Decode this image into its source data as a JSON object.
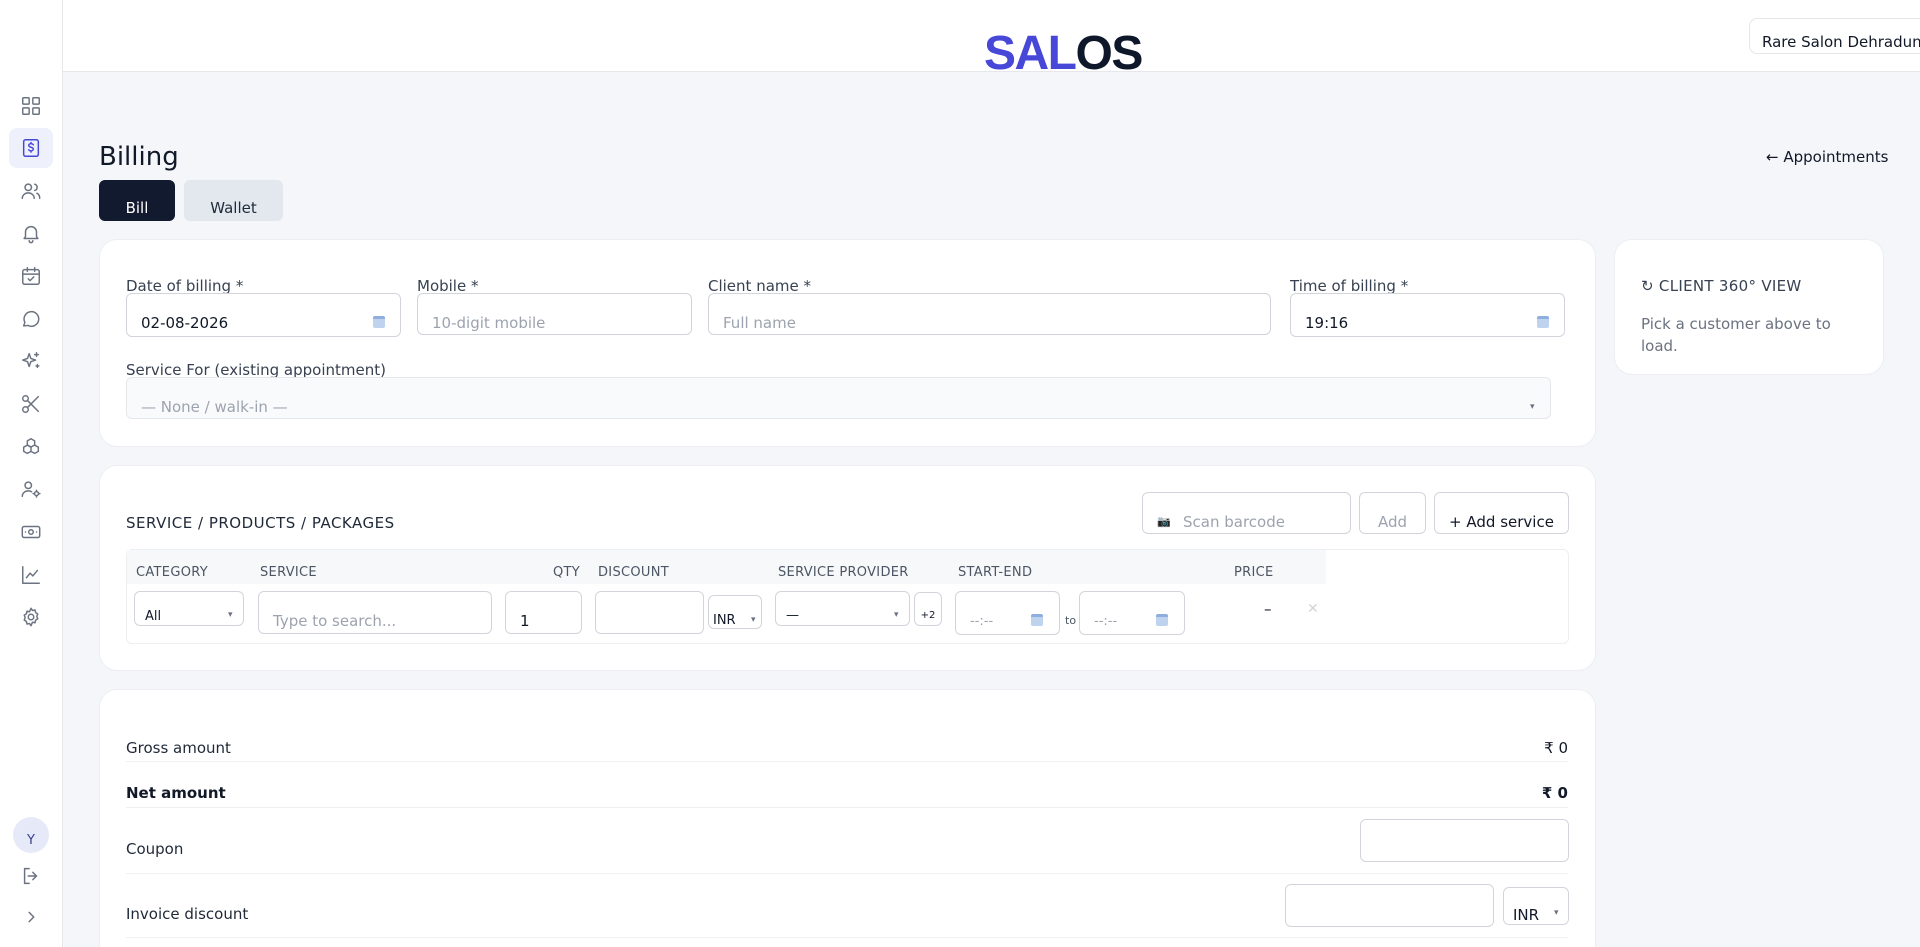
{
  "app": {
    "logo_a": "SAL",
    "logo_b": "OS"
  },
  "header": {
    "salon": "Rare Salon Dehradun"
  },
  "sidebar": {
    "items": [
      {
        "name": "dashboard-icon"
      },
      {
        "name": "billing-icon"
      },
      {
        "name": "clients-icon"
      },
      {
        "name": "bell-icon"
      },
      {
        "name": "calendar-icon"
      },
      {
        "name": "chat-icon"
      },
      {
        "name": "sparkles-icon"
      },
      {
        "name": "scissors-icon"
      },
      {
        "name": "packages-icon"
      },
      {
        "name": "staff-icon"
      },
      {
        "name": "cash-icon"
      },
      {
        "name": "chart-icon"
      },
      {
        "name": "settings-icon"
      }
    ],
    "avatar": "Y"
  },
  "page": {
    "title": "Billing",
    "back_link": "← Appointments",
    "tabs": [
      "Bill",
      "Wallet"
    ]
  },
  "form": {
    "date_label": "Date of billing *",
    "date_value": "02-08-2026",
    "mobile_label": "Mobile *",
    "mobile_placeholder": "10-digit mobile",
    "client_label": "Client name *",
    "client_placeholder": "Full name",
    "time_label": "Time of billing *",
    "time_value": "19:16",
    "service_for_label": "Service For (existing appointment)",
    "service_for_value": "— None / walk-in —"
  },
  "client_view": {
    "title": "↻ CLIENT 360° VIEW",
    "hint": "Pick a customer above to load."
  },
  "services": {
    "title": "SERVICE / PRODUCTS / PACKAGES",
    "scan_placeholder": "Scan barcode",
    "scan_icon": "📷",
    "add_label": "Add",
    "add_service_label": "+ Add service",
    "columns": [
      "CATEGORY",
      "SERVICE",
      "QTY",
      "DISCOUNT",
      "SERVICE PROVIDER",
      "START-END",
      "PRICE"
    ],
    "row": {
      "category": "All",
      "service_placeholder": "Type to search...",
      "qty": "1",
      "discount": "",
      "currency": "INR",
      "provider": "—",
      "provider_extra": "+2",
      "start": "--:--",
      "to": "to",
      "end": "--:--",
      "price": "–",
      "remove": "✕"
    }
  },
  "summary": {
    "gross_label": "Gross amount",
    "gross_value": "₹ 0",
    "net_label": "Net amount",
    "net_value": "₹ 0",
    "coupon_label": "Coupon",
    "invoice_discount_label": "Invoice discount",
    "invoice_currency": "INR"
  }
}
